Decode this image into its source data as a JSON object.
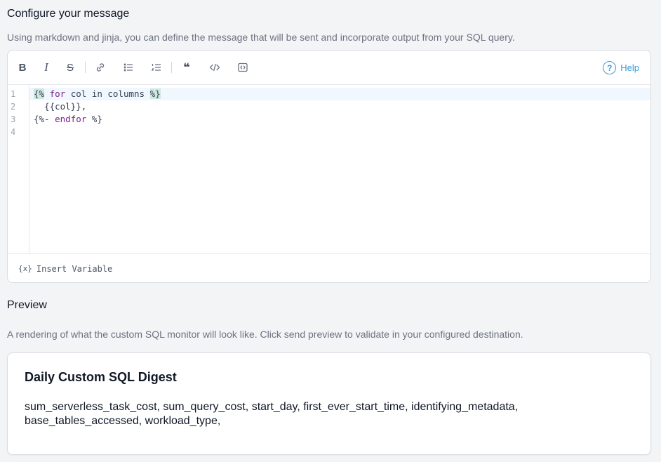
{
  "configure": {
    "title": "Configure your message",
    "description": "Using markdown and jinja, you can define the message that will be sent and incorporate output from your SQL query."
  },
  "toolbar": {
    "bold": "B",
    "italic": "I",
    "strike": "S",
    "quote": "❝",
    "help_label": "Help"
  },
  "editor": {
    "line_numbers": [
      "1",
      "2",
      "3",
      "4"
    ],
    "lines": [
      {
        "open": "{%",
        "kw": "for",
        "text": " col in columns ",
        "close": "%}"
      },
      {
        "text": "  {{col}},"
      },
      {
        "open": "{%-",
        "kw": "endfor",
        "close": "%}"
      },
      {
        "text": ""
      }
    ],
    "insert_variable_icon": "{x}",
    "insert_variable_label": "Insert Variable"
  },
  "preview": {
    "title": "Preview",
    "description": "A rendering of what the custom SQL monitor will look like. Click send preview to validate in your configured destination.",
    "card_title": "Daily Custom SQL Digest",
    "card_body": "sum_serverless_task_cost, sum_query_cost, start_day, first_ever_start_time, identifying_metadata, base_tables_accessed, workload_type,"
  },
  "colors": {
    "accent": "#3b9ad9",
    "keyword": "#7c1f8b",
    "highlight": "#cfe8df"
  }
}
